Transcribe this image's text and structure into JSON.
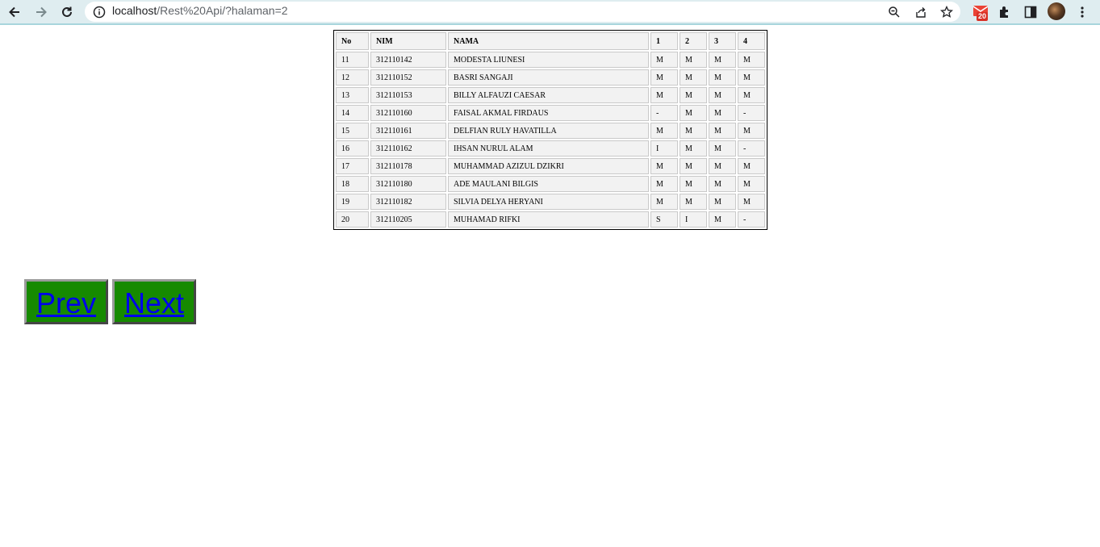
{
  "browser": {
    "url_host": "localhost",
    "url_path": "/Rest%20Api/?halaman=2",
    "extension_badge": "20"
  },
  "table": {
    "headers": [
      "No",
      "NIM",
      "NAMA",
      "1",
      "2",
      "3",
      "4"
    ],
    "rows": [
      [
        "11",
        "312110142",
        "MODESTA LIUNESI",
        "M",
        "M",
        "M",
        "M"
      ],
      [
        "12",
        "312110152",
        "BASRI SANGAJI",
        "M",
        "M",
        "M",
        "M"
      ],
      [
        "13",
        "312110153",
        "BILLY ALFAUZI CAESAR",
        "M",
        "M",
        "M",
        "M"
      ],
      [
        "14",
        "312110160",
        "FAISAL AKMAL FIRDAUS",
        "-",
        "M",
        "M",
        "-"
      ],
      [
        "15",
        "312110161",
        "DELFIAN RULY HAVATILLA",
        "M",
        "M",
        "M",
        "M"
      ],
      [
        "16",
        "312110162",
        "IHSAN NURUL ALAM",
        "I",
        "M",
        "M",
        "-"
      ],
      [
        "17",
        "312110178",
        "MUHAMMAD AZIZUL DZIKRI",
        "M",
        "M",
        "M",
        "M"
      ],
      [
        "18",
        "312110180",
        "ADE MAULANI BILGIS",
        "M",
        "M",
        "M",
        "M"
      ],
      [
        "19",
        "312110182",
        "SILVIA DELYA HERYANI",
        "M",
        "M",
        "M",
        "M"
      ],
      [
        "20",
        "312110205",
        "MUHAMAD RIFKI",
        "S",
        "I",
        "M",
        "-"
      ]
    ]
  },
  "pagination": {
    "prev_label": "Prev",
    "next_label": "Next"
  },
  "colors": {
    "button_bg": "#168a00",
    "link": "#0000ee",
    "toolbar_bg": "#dfedf0"
  }
}
